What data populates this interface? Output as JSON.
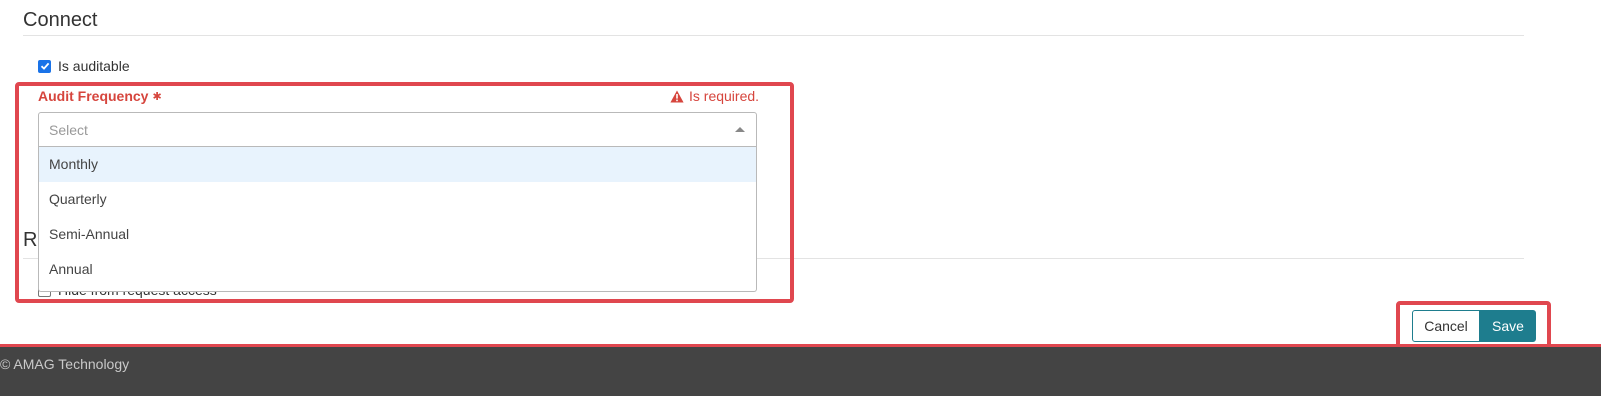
{
  "sections": {
    "connect_title": "Connect",
    "next_title_partial": "R"
  },
  "auditable": {
    "label": "Is auditable",
    "checked": true
  },
  "audit_frequency": {
    "label": "Audit Frequency",
    "required_marker": "✱",
    "error_icon": "warning-icon",
    "error_text": "Is required.",
    "placeholder": "Select",
    "value": "",
    "options": [
      "Monthly",
      "Quarterly",
      "Semi-Annual",
      "Annual"
    ],
    "highlighted_option": "Monthly"
  },
  "hide_request": {
    "label": "Hide from request access",
    "checked": false
  },
  "actions": {
    "cancel_label": "Cancel",
    "save_label": "Save"
  },
  "footer": {
    "copyright": "© AMAG Technology"
  },
  "colors": {
    "error": "#d6453d",
    "highlight": "#e0474f",
    "primary": "#1e7d8e",
    "footer_bg": "#444444",
    "option_hover": "#e8f3fd"
  }
}
